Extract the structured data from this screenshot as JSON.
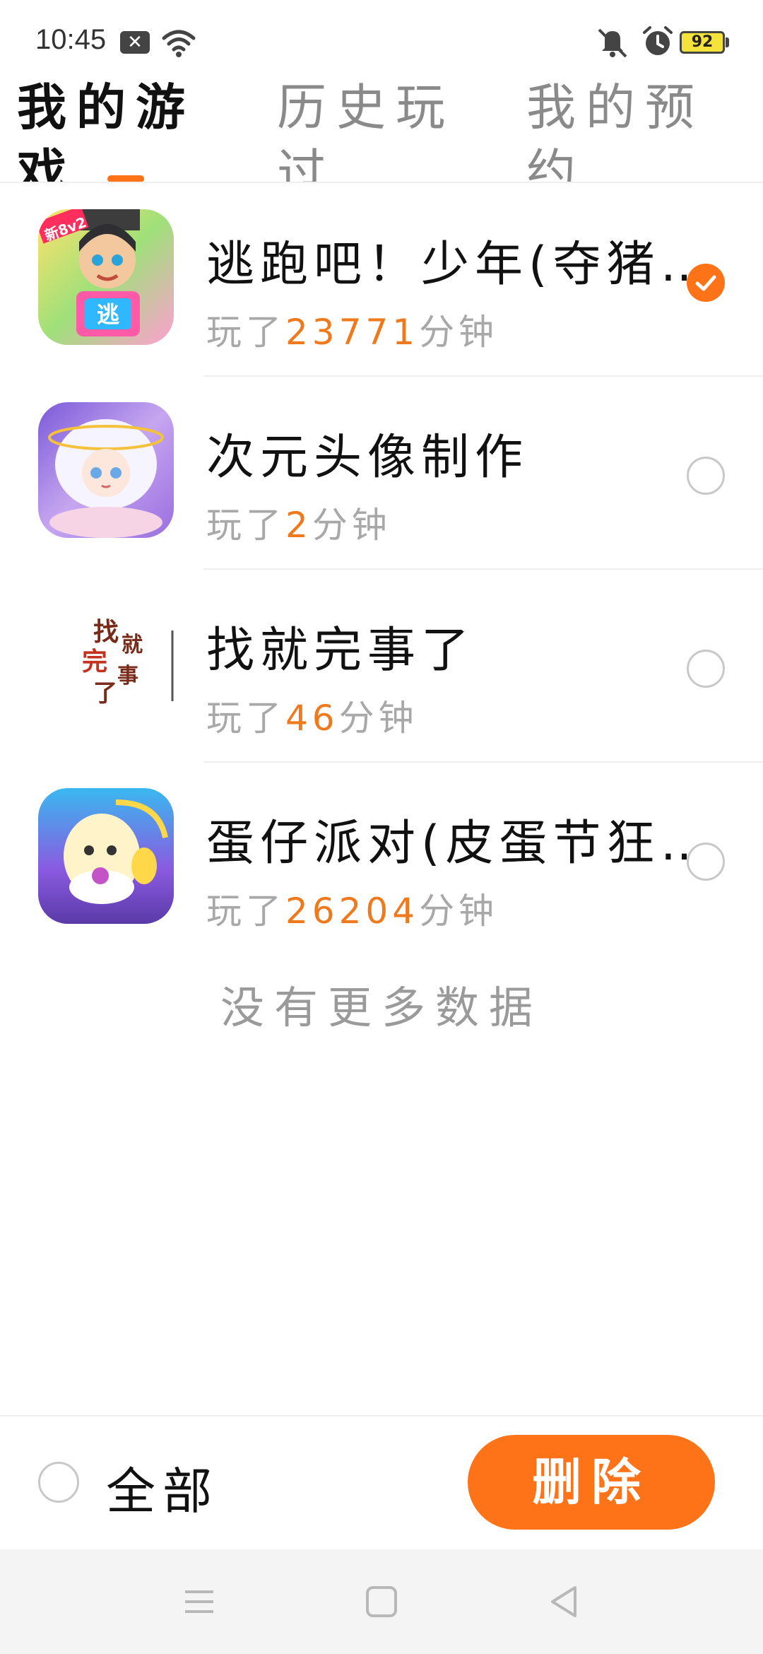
{
  "status_bar": {
    "time": "10:45",
    "battery": "92",
    "icons": [
      "notification-icon",
      "wifi-icon",
      "mute-icon",
      "alarm-icon",
      "battery-icon"
    ]
  },
  "tabs": [
    {
      "label": "我的游戏",
      "active": true
    },
    {
      "label": "历史玩过",
      "active": false
    },
    {
      "label": "我的预约",
      "active": false
    }
  ],
  "games": [
    {
      "title": "逃跑吧！少年(夺猪节)",
      "prefix": "玩了",
      "minutes": "23771",
      "suffix": "分钟",
      "selected": true
    },
    {
      "title": "次元头像制作",
      "prefix": "玩了",
      "minutes": "2",
      "suffix": "分钟",
      "selected": false
    },
    {
      "title": "找就完事了",
      "prefix": "玩了",
      "minutes": "46",
      "suffix": "分钟",
      "selected": false
    },
    {
      "title": "蛋仔派对(皮蛋节狂欢)",
      "prefix": "玩了",
      "minutes": "26204",
      "suffix": "分钟",
      "selected": false
    }
  ],
  "icon_badges": {
    "game1": "新8v2",
    "game1_sign": "逃",
    "game3": [
      "找",
      "就",
      "完",
      "事",
      "了"
    ]
  },
  "no_more_text": "没有更多数据",
  "bottom_bar": {
    "select_all_label": "全部",
    "delete_label": "删除"
  },
  "colors": {
    "accent": "#ff7318",
    "minutes_highlight": "#ef7a1e",
    "secondary_text": "#a8a8a8"
  }
}
